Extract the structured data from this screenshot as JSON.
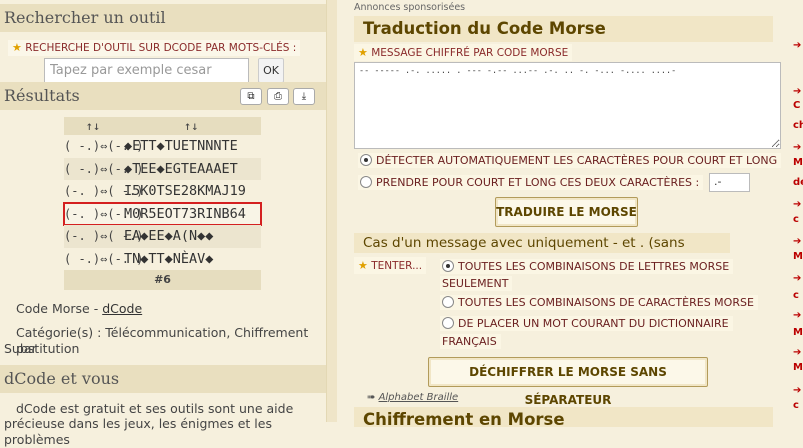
{
  "sidebar": {
    "search_title": "Rechercher un outil",
    "keyword_label": "RECHERCHE D'OUTIL SUR DCODE PAR MOTS-CLÉS :",
    "search_placeholder": "Tapez par exemple cesar",
    "ok_label": "OK",
    "results_title": "Résultats",
    "tool_icons": [
      "copy-icon",
      "print-icon",
      "download-icon"
    ],
    "results": {
      "head_col1": "↑↓",
      "head_col2": "↑↓",
      "rows": [
        {
          "key": "( -.)⇔(-. )",
          "value": "◆ETT◆TUETNNNTE"
        },
        {
          "key": "( -.)⇔(-. )",
          "value": "◆TEE◆EGTEAAAET"
        },
        {
          "key": "(-. )⇔( -.)",
          "value": "I5K0TSE28KMAJ19"
        },
        {
          "key": "(-. )⇔(-. )",
          "value": "M0R5EOT73RINB64"
        },
        {
          "key": "(-. )⇔( -.)",
          "value": "EA◆EE◆A(N◆◆"
        },
        {
          "key": "( -.)⇔(-. )",
          "value": "TN◆TT◆NÈAV◆"
        }
      ],
      "footer": "#6"
    },
    "tool_name_prefix": "Code Morse - ",
    "tool_name_link": "dCode",
    "category_line1": "Catégorie(s) : Télécommunication, Chiffrement par",
    "category_line2": "Substitution",
    "dcode_title": "dCode et vous",
    "dcode_text1": "dCode est gratuit et ses outils sont une aide",
    "dcode_text2": "précieuse dans les jeux, les énigmes et les problèmes"
  },
  "main": {
    "ads_label": "Annonces sponsorisées",
    "translation_title": "Traduction du Code Morse",
    "cipher_label": "MESSAGE CHIFFRÉ PAR CODE MORSE",
    "cipher_value": "-- ----- .-. ..... . --- -.-- ...-- .-. .. -. -... -.... ....-",
    "radio_auto": "DÉTECTER AUTOMATIQUEMENT LES CARACTÈRES POUR COURT ET LONG",
    "radio_custom": "PRENDRE POUR COURT ET LONG CES DEUX CARACTÈRES :",
    "separator_value": ".-",
    "translate_button": "TRADUIRE LE MORSE",
    "case_title": "Cas d'un message avec uniquement - et . (sans espace)",
    "try_label": "TENTER...",
    "opt_letters_line1": "TOUTES LES COMBINAISONS DE LETTRES MORSE",
    "opt_letters_line2": "SEULEMENT",
    "opt_chars": "TOUTES LES COMBINAISONS DE CARACTÈRES MORSE",
    "opt_dict_line1": "DE PLACER UN MOT COURANT DU DICTIONNAIRE",
    "opt_dict_line2": "FRANÇAIS",
    "decrypt_button": "DÉCHIFFRER LE MORSE SANS SÉPARATEUR",
    "alphabet_link": "Alphabet Braille",
    "encrypt_title": "Chiffrement en Morse"
  },
  "strip": [
    "C",
    "ch",
    "M",
    "de",
    "c",
    "M",
    "c",
    "M",
    "M",
    "c",
    "M",
    "c"
  ]
}
